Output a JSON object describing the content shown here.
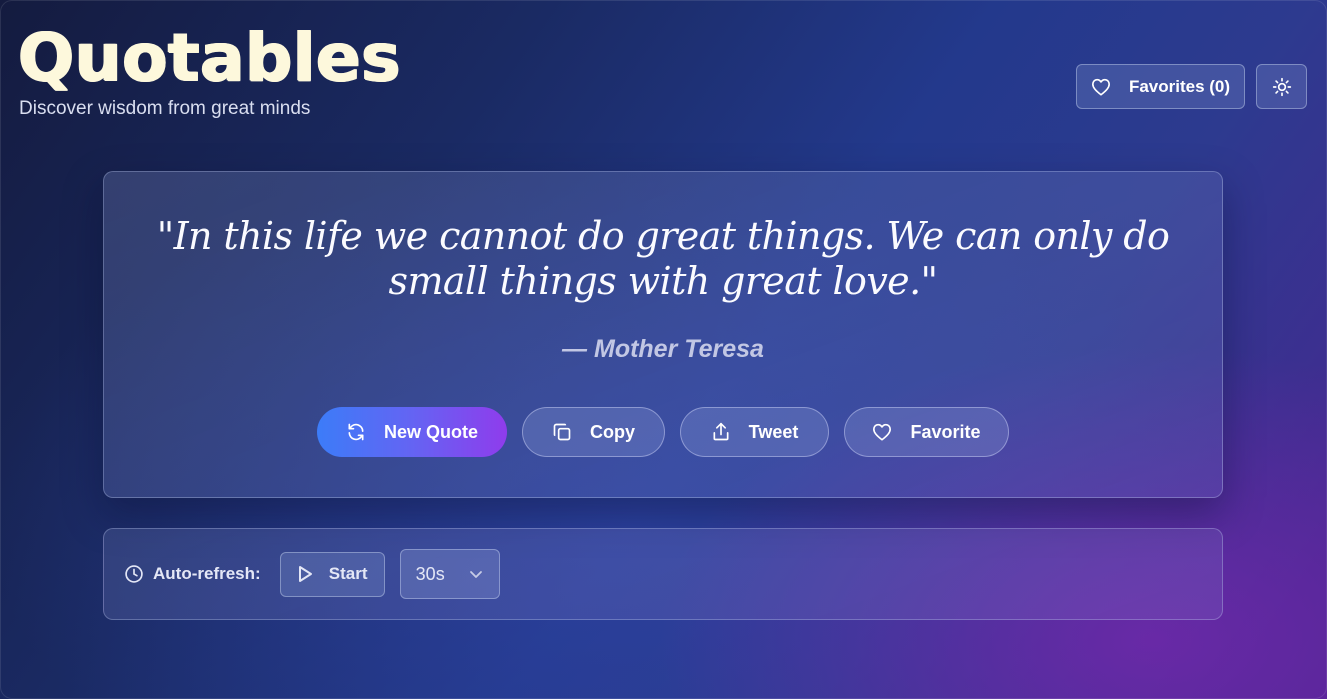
{
  "header": {
    "title": "Quotables",
    "subtitle": "Discover wisdom from great minds",
    "favorites_label": "Favorites (0)",
    "favorites_icon": "heart-icon",
    "theme_icon": "sun-icon"
  },
  "quote": {
    "text": "\"In this life we cannot do great things. We can only do small things with great love.\"",
    "author": "— Mother Teresa"
  },
  "actions": {
    "new_quote": {
      "label": "New Quote",
      "icon": "refresh-icon"
    },
    "copy": {
      "label": "Copy",
      "icon": "copy-icon"
    },
    "tweet": {
      "label": "Tweet",
      "icon": "share-icon"
    },
    "favorite": {
      "label": "Favorite",
      "icon": "heart-icon"
    }
  },
  "auto_refresh": {
    "label": "Auto-refresh:",
    "icon": "clock-icon",
    "start_label": "Start",
    "start_icon": "play-icon",
    "interval_value": "30s",
    "interval_icon": "chevron-down-icon"
  },
  "colors": {
    "title": "#fdf8dc",
    "primary_gradient_start": "#3c7cf8",
    "primary_gradient_end": "#8f3cec",
    "background_start": "#141b3f",
    "background_end": "#4a2590"
  }
}
